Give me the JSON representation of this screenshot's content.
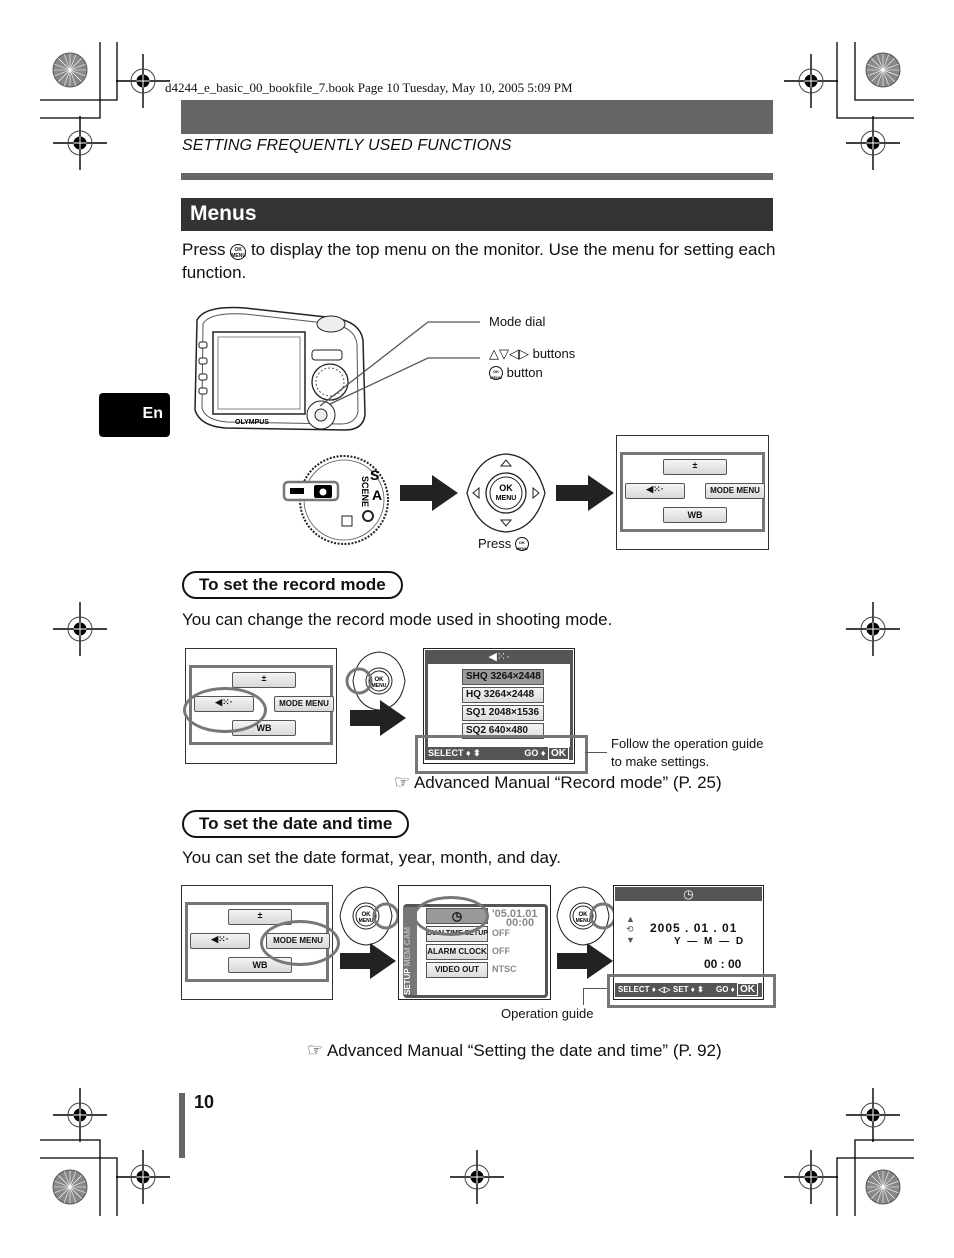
{
  "header": {
    "book_line": "d4244_e_basic_00_bookfile_7.book  Page 10  Tuesday, May 10, 2005  5:09 PM",
    "section_label": "SETTING FREQUENTLY USED FUNCTIONS"
  },
  "side_tab": {
    "label": "En"
  },
  "menus": {
    "title": "Menus",
    "intro_before": "Press",
    "intro_icon": "ok-menu-button-icon",
    "intro_after": "to display the top menu on the monitor. Use the menu for setting each function."
  },
  "camera_figure": {
    "brand": "OLYMPUS",
    "callouts": {
      "mode_dial": "Mode dial",
      "arrow_buttons": "△▽◁▷ buttons",
      "ok_button": "button"
    },
    "dial_labels": {
      "scene": "SCENE",
      "s": "S",
      "a": "A"
    },
    "pad": {
      "ok": "OK",
      "menu": "MENU"
    },
    "press_label": "Press",
    "top_menu": {
      "top": "±",
      "left": "◀⁙·",
      "right": "MODE MENU",
      "bottom": "WB"
    }
  },
  "record_mode": {
    "heading": "To set the record mode",
    "description": "You can change the record mode used in shooting mode.",
    "screen_title": "◀⁙·",
    "options": [
      {
        "label": "SHQ 3264×2448",
        "selected": true
      },
      {
        "label": "HQ  3264×2448",
        "selected": false
      },
      {
        "label": "SQ1 2048×1536",
        "selected": false
      },
      {
        "label": "SQ2   640×480",
        "selected": false
      }
    ],
    "guide": {
      "select": "SELECT ♦ ⬍",
      "go": "GO ♦",
      "ok": "OK"
    },
    "callout": "Follow the operation guide to make settings.",
    "reference": "Advanced Manual “Record mode” (P. 25)"
  },
  "date_time": {
    "heading": "To set the date and time",
    "description": "You can set the date format, year, month, and day.",
    "setup_tabs": [
      "CAM",
      "MEM",
      "SETUP"
    ],
    "setup_items": [
      {
        "label": "◷",
        "value": "'05.01.01",
        "value2": "00:00"
      },
      {
        "label": "DUALTIME SETUP",
        "value": "OFF"
      },
      {
        "label": "ALARM CLOCK",
        "value": "OFF"
      },
      {
        "label": "VIDEO OUT",
        "value": "NTSC"
      }
    ],
    "clock_screen": {
      "title": "◷",
      "date": "2005 . 01 . 01",
      "format": "Y — M — D",
      "time": "00 : 00",
      "guide": {
        "select": "SELECT ♦ ◁▷",
        "set": "SET ♦ ⬍",
        "go": "GO ♦",
        "ok": "OK"
      }
    },
    "callout": "Operation guide",
    "reference": "Advanced Manual “Setting the date and time” (P. 92)"
  },
  "footer": {
    "page_number": "10"
  },
  "colors": {
    "bar_gray": "#666666",
    "title_bar": "#333333",
    "tab_black": "#000000",
    "highlight_ring": "#777777"
  }
}
